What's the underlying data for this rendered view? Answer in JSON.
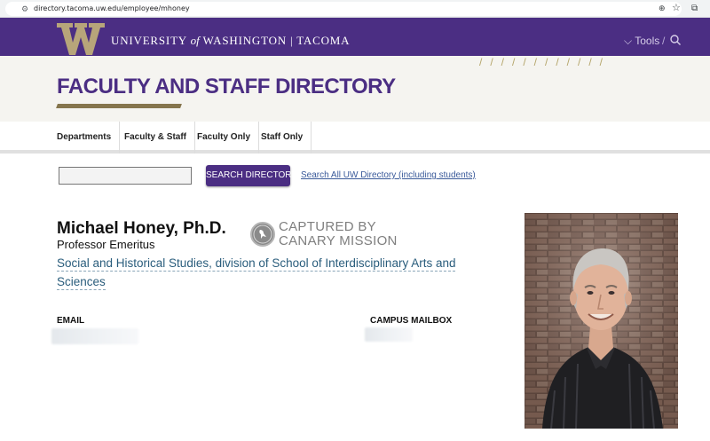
{
  "browser": {
    "url": "directory.tacoma.uw.edu/employee/mhoney"
  },
  "header": {
    "wordmark_left": "UNIVERSITY",
    "wordmark_of": "of",
    "wordmark_right": "WASHINGTON | TACOMA",
    "tools_label": "Tools",
    "slash": "/"
  },
  "title_band": {
    "title": "FACULTY AND STAFF DIRECTORY",
    "decor": "////////////"
  },
  "nav": {
    "items": [
      {
        "label": "Departments"
      },
      {
        "label": "Faculty & Staff"
      },
      {
        "label": "Faculty Only"
      },
      {
        "label": "Staff Only"
      }
    ]
  },
  "search": {
    "value": "",
    "button_label": "SEARCH DIRECTORY",
    "all_link": "Search All UW Directory (including students)"
  },
  "profile": {
    "name": "Michael Honey, Ph.D.",
    "title": "Professor Emeritus",
    "department_line1": "Social and Historical Studies, division of School of Interdisciplinary Arts and",
    "department_line2": "Sciences",
    "email_label": "EMAIL",
    "mailbox_label": "CAMPUS MAILBOX"
  },
  "stamp": {
    "line1": "CAPTURED BY",
    "line2": "CANARY MISSION"
  },
  "colors": {
    "uw_purple": "#4b2e83",
    "uw_gold": "#b7a57a",
    "link_blue": "#2a5d7c"
  }
}
